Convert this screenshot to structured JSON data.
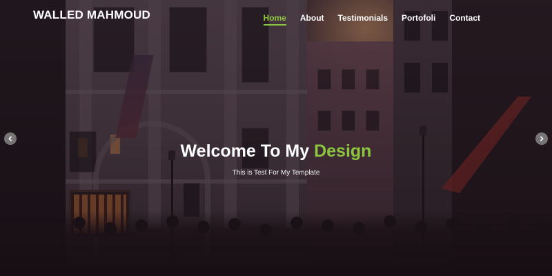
{
  "brand": {
    "name": "WALLED MAHMOUD"
  },
  "nav": {
    "items": [
      {
        "label": "Home",
        "active": true
      },
      {
        "label": "About",
        "active": false
      },
      {
        "label": "Testimonials",
        "active": false
      },
      {
        "label": "Portofoli",
        "active": false
      },
      {
        "label": "Contact",
        "active": false
      }
    ]
  },
  "hero": {
    "title_main": "Welcome To My ",
    "title_accent": "Design",
    "subtitle": "This is Test For My Template"
  },
  "carousel": {
    "prev_icon": "chevron-left-icon",
    "next_icon": "chevron-right-icon"
  },
  "colors": {
    "accent": "#8cc63f",
    "text": "#ffffff",
    "arrow_bg": "#969696"
  }
}
